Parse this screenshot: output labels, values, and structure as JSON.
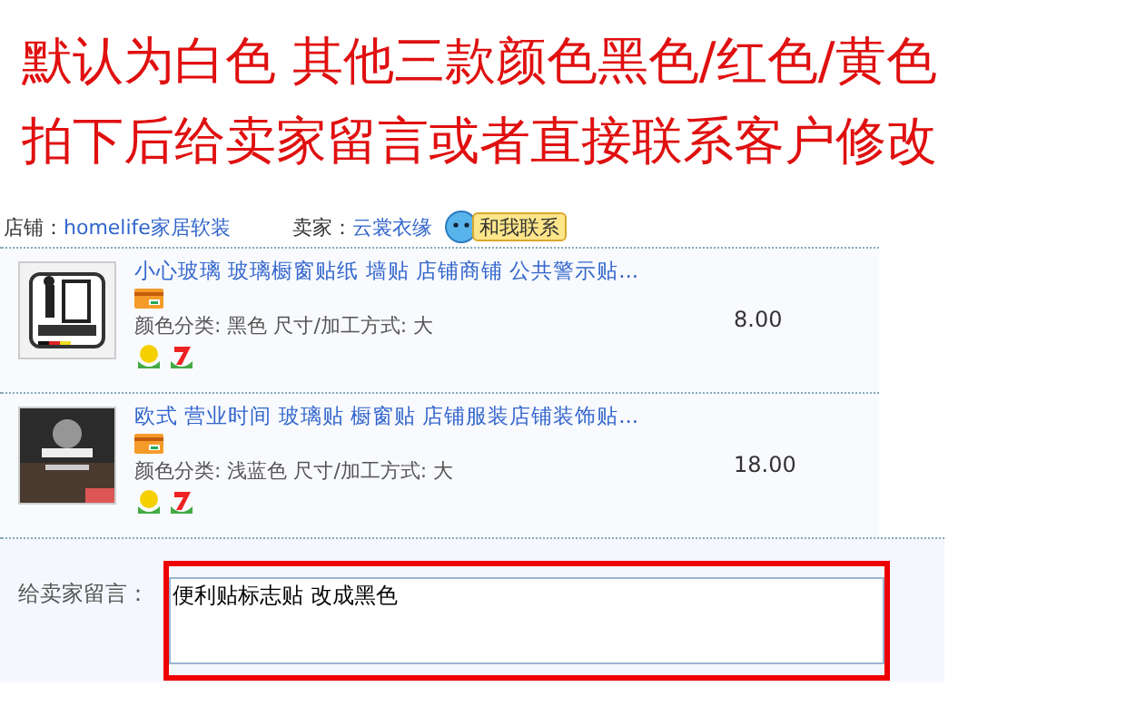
{
  "headline": [
    "默认为白色 其他三款颜色黑色/红色/黄色",
    "拍下后给卖家留言或者直接联系客户修改"
  ],
  "shop": {
    "label": "店铺：",
    "name": "homelife家居软装",
    "seller_label": "卖家：",
    "seller": "云裳衣缘",
    "contact": "和我联系"
  },
  "items": [
    {
      "title": "小心玻璃 玻璃橱窗贴纸 墙贴 店铺商铺 公共警示贴...",
      "spec": "颜色分类: 黑色   尺寸/加工方式: 大",
      "price": "8.00",
      "kind": "picture"
    },
    {
      "title": "欧式 营业时间 玻璃贴 橱窗贴 店铺服装店铺装饰贴...",
      "spec": "颜色分类: 浅蓝色   尺寸/加工方式: 大",
      "price": "18.00",
      "kind": "picture"
    }
  ],
  "message": {
    "label": "给卖家留言：",
    "value": "便利贴标志贴 改成黑色"
  }
}
